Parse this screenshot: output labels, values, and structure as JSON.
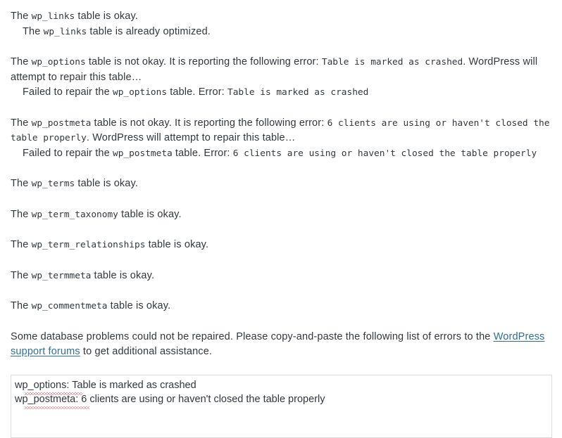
{
  "page": {
    "background": "#ffffff",
    "text_color": "#32373c",
    "link_color": "#2d6f96",
    "error_underline_color": "#e03a3a"
  },
  "results": [
    {
      "id": "wp_links-status",
      "segments": [
        {
          "type": "text",
          "value": "The "
        },
        {
          "type": "code",
          "value": "wp_links"
        },
        {
          "type": "text",
          "value": " table is okay."
        }
      ],
      "plain": "The wp_links table is okay."
    },
    {
      "id": "wp_links-optimized",
      "indent": true,
      "segments": [
        {
          "type": "text",
          "value": "The "
        },
        {
          "type": "code",
          "value": "wp_links"
        },
        {
          "type": "text",
          "value": " table is already optimized."
        }
      ],
      "plain": "The wp_links table is already optimized."
    },
    {
      "id": "wp_options-status",
      "segments": [
        {
          "type": "text",
          "value": "The "
        },
        {
          "type": "code",
          "value": "wp_options"
        },
        {
          "type": "text",
          "value": " table is not okay. It is reporting the following error: "
        },
        {
          "type": "code",
          "value": "Table is marked as crashed"
        },
        {
          "type": "text",
          "value": ". WordPress will attempt to repair this table…"
        }
      ],
      "plain": "The wp_options table is not okay. It is reporting the following error: Table is marked as crashed. WordPress will attempt to repair this table…"
    },
    {
      "id": "wp_options-repair-failed",
      "indent": true,
      "segments": [
        {
          "type": "text",
          "value": "Failed to repair the "
        },
        {
          "type": "code",
          "value": "wp_options"
        },
        {
          "type": "text",
          "value": " table. Error: "
        },
        {
          "type": "code",
          "value": "Table is marked as crashed"
        }
      ],
      "plain": "Failed to repair the wp_options table. Error: Table is marked as crashed"
    },
    {
      "id": "wp_postmeta-status",
      "segments": [
        {
          "type": "text",
          "value": "The "
        },
        {
          "type": "code",
          "value": "wp_postmeta"
        },
        {
          "type": "text",
          "value": " table is not okay. It is reporting the following error: "
        },
        {
          "type": "code",
          "value": "6 clients are using or haven't closed the table properly"
        },
        {
          "type": "text",
          "value": ". WordPress will attempt to repair this table…"
        }
      ],
      "plain": "The wp_postmeta table is not okay. It is reporting the following error: 6 clients are using or haven't closed the table properly. WordPress will attempt to repair this table…"
    },
    {
      "id": "wp_postmeta-repair-failed",
      "indent": true,
      "segments": [
        {
          "type": "text",
          "value": "Failed to repair the "
        },
        {
          "type": "code",
          "value": "wp_postmeta"
        },
        {
          "type": "text",
          "value": " table. Error: "
        },
        {
          "type": "code",
          "value": "6 clients are using or haven't closed the table properly"
        }
      ],
      "plain": "Failed to repair the wp_postmeta table. Error: 6 clients are using or haven't closed the table properly"
    },
    {
      "id": "wp_terms-status",
      "segments": [
        {
          "type": "text",
          "value": "The "
        },
        {
          "type": "code",
          "value": "wp_terms"
        },
        {
          "type": "text",
          "value": " table is okay."
        }
      ],
      "plain": "The wp_terms table is okay."
    },
    {
      "id": "wp_term_taxonomy-status",
      "segments": [
        {
          "type": "text",
          "value": "The "
        },
        {
          "type": "code",
          "value": "wp_term_taxonomy"
        },
        {
          "type": "text",
          "value": " table is okay."
        }
      ],
      "plain": "The wp_term_taxonomy table is okay."
    },
    {
      "id": "wp_term_relationships-status",
      "segments": [
        {
          "type": "text",
          "value": "The "
        },
        {
          "type": "code",
          "value": "wp_term_relationships"
        },
        {
          "type": "text",
          "value": " table is okay."
        }
      ],
      "plain": "The wp_term_relationships table is okay."
    },
    {
      "id": "wp_termmeta-status",
      "segments": [
        {
          "type": "text",
          "value": "The "
        },
        {
          "type": "code",
          "value": "wp_termmeta"
        },
        {
          "type": "text",
          "value": " table is okay."
        }
      ],
      "plain": "The wp_termmeta table is okay."
    },
    {
      "id": "wp_commentmeta-status",
      "segments": [
        {
          "type": "text",
          "value": "The "
        },
        {
          "type": "code",
          "value": "wp_commentmeta"
        },
        {
          "type": "text",
          "value": " table is okay."
        }
      ],
      "plain": "The wp_commentmeta table is okay."
    }
  ],
  "summary": {
    "lead": "Some database problems could not be repaired. Please copy-and-paste the following list of errors to the ",
    "link_label": "WordPress support forums",
    "trail": " to get additional assistance."
  },
  "errors_textarea": {
    "lines": [
      "wp_options: Table is marked as crashed",
      "wp_postmeta: 6 clients are using or haven't closed the table properly"
    ],
    "value": "wp_options: Table is marked as crashed\nwp_postmeta: 6 clients are using or haven't closed the table properly",
    "misspelled": [
      "wp_options",
      "wp_postmeta"
    ]
  }
}
